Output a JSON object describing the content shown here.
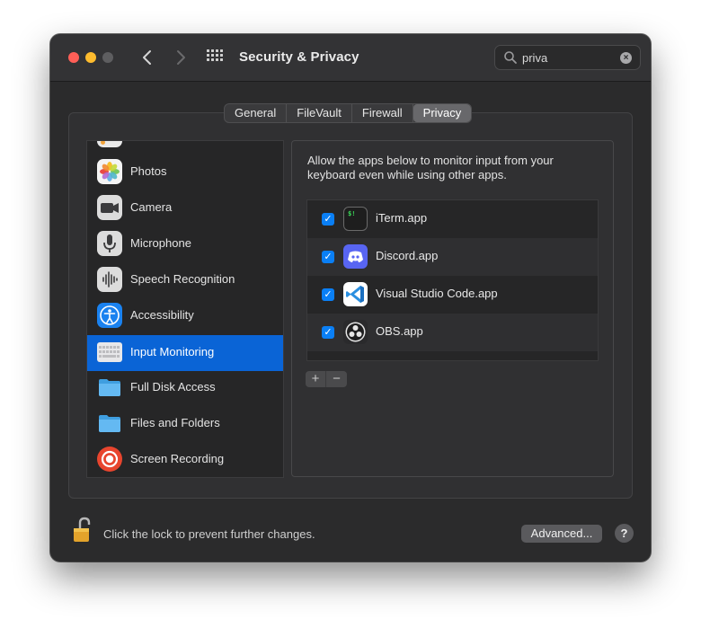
{
  "window": {
    "title": "Security & Privacy",
    "traffic_lights": {
      "close": "#ff5f57",
      "minimize": "#febc2e",
      "zoom": "#5e5e60"
    }
  },
  "toolbar": {
    "back_icon": "chevron-left-icon",
    "forward_icon": "chevron-right-icon",
    "grid_icon": "show-all-grid-icon"
  },
  "search": {
    "value": "priva",
    "placeholder": "Search",
    "clear_icon": "clear-icon"
  },
  "tabs": [
    {
      "label": "General",
      "active": false
    },
    {
      "label": "FileVault",
      "active": false
    },
    {
      "label": "Firewall",
      "active": false
    },
    {
      "label": "Privacy",
      "active": true
    }
  ],
  "sidebar": {
    "items": [
      {
        "label": "Photos",
        "icon": "photos-icon",
        "selected": false
      },
      {
        "label": "Camera",
        "icon": "camera-icon",
        "selected": false
      },
      {
        "label": "Microphone",
        "icon": "microphone-icon",
        "selected": false
      },
      {
        "label": "Speech Recognition",
        "icon": "speech-waveform-icon",
        "selected": false
      },
      {
        "label": "Accessibility",
        "icon": "accessibility-icon",
        "selected": false
      },
      {
        "label": "Input Monitoring",
        "icon": "keyboard-icon",
        "selected": true
      },
      {
        "label": "Full Disk Access",
        "icon": "folder-icon",
        "selected": false
      },
      {
        "label": "Files and Folders",
        "icon": "folder-icon",
        "selected": false
      },
      {
        "label": "Screen Recording",
        "icon": "screen-recording-icon",
        "selected": false
      }
    ]
  },
  "main": {
    "description": "Allow the apps below to monitor input from your keyboard even while using other apps.",
    "apps": [
      {
        "label": "iTerm.app",
        "checked": true,
        "icon": "iterm-icon"
      },
      {
        "label": "Discord.app",
        "checked": true,
        "icon": "discord-icon"
      },
      {
        "label": "Visual Studio Code.app",
        "checked": true,
        "icon": "vscode-icon"
      },
      {
        "label": "OBS.app",
        "checked": true,
        "icon": "obs-icon"
      }
    ],
    "add_label": "+",
    "remove_label": "−"
  },
  "footer": {
    "lock_text": "Click the lock to prevent further changes.",
    "advanced_label": "Advanced...",
    "help_label": "?"
  },
  "colors": {
    "selection": "#0a64d6",
    "checkbox": "#0a7ff5",
    "window_bg": "#2b2b2c"
  }
}
